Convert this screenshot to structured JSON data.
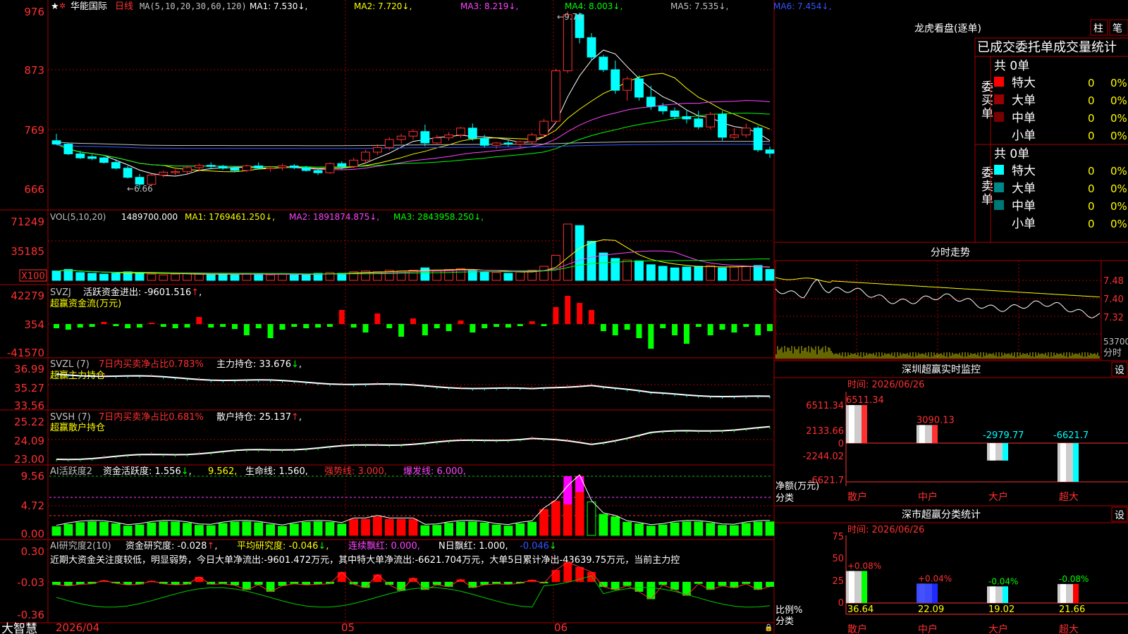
{
  "header": {
    "stock_name": "华能国际",
    "period": "日线",
    "ma_title": "MA(5,10,20,30,60,120)",
    "ma": [
      {
        "label": "MA1: 7.530",
        "arrow": "↓",
        "color": "#ffffff"
      },
      {
        "label": "MA2: 7.720",
        "arrow": "↓",
        "color": "#ffff00"
      },
      {
        "label": "MA3: 8.219",
        "arrow": "↓",
        "color": "#ff44ff"
      },
      {
        "label": "MA4: 8.003",
        "arrow": "↓",
        "color": "#00ff00"
      },
      {
        "label": "MA5: 7.535",
        "arrow": "↓",
        "color": "#c0c0c0"
      },
      {
        "label": "MA6: 7.454",
        "arrow": "↓",
        "color": "#3355ff"
      }
    ]
  },
  "price_axis": [
    "976",
    "873",
    "769",
    "666"
  ],
  "price_annotations": {
    "high": "9.76",
    "low": "6.66"
  },
  "vol_panel": {
    "title": "VOL(5,10,20)",
    "value": "1489700.000",
    "ma": [
      {
        "label": "MA1: 1769461.250",
        "arrow": "↓",
        "color": "#ffff00"
      },
      {
        "label": "MA2: 1891874.875",
        "arrow": "↓",
        "color": "#ff44ff"
      },
      {
        "label": "MA3: 2843958.250",
        "arrow": "↓",
        "color": "#00ff00"
      }
    ],
    "axis": [
      "71249",
      "35185"
    ],
    "unit": "X100"
  },
  "svzj_panel": {
    "name": "SVZJ",
    "line1": "活跃资金进出: -9601.516",
    "arrow": "↑",
    "line2": "超赢资金流(万元)",
    "axis": [
      "42279",
      "354",
      "-41570"
    ]
  },
  "svzl_panel": {
    "name": "SVZL (7)",
    "ratio": "7日内买卖净占比0.783%",
    "holding": "主力持仓: 33.676",
    "arrow": "↓",
    "line2": "超赢主力持仓",
    "axis": [
      "36.99",
      "35.27",
      "33.56"
    ]
  },
  "svsh_panel": {
    "name": "SVSH (7)",
    "ratio": "7日内买卖净占比0.681%",
    "holding": "散户持仓: 25.137",
    "arrow": "↑",
    "line2": "超赢散户持仓",
    "axis": [
      "25.22",
      "24.09",
      "23.00"
    ]
  },
  "ai_active_panel": {
    "name": "AI活跃度2",
    "activity": "资金活跃度: 1.556",
    "a1": "↓",
    "v2": "9.562",
    "life": "生命线: 1.560",
    "strong": "强势线: 3.000",
    "burst": "爆发线: 6.000",
    "axis": [
      "9.56",
      "4.72",
      "0.00"
    ]
  },
  "ai_research_panel": {
    "name": "AI研究度2(10)",
    "research": "资金研究度: -0.028",
    "avg": "平均研究度: -0.046",
    "lianxu": "连续飘红: 0.000",
    "nday": "N日飘红: 1.000",
    "last": "-0.046",
    "comment": "近期大资金关注度较低，明显弱势，今日大单净流出:-9601.472万元，其中特大单净流出:-6621.704万元，大单5日累计净出-43639.75万元，当前主力控",
    "axis": [
      "0.30",
      "-0.03",
      "-0.36"
    ]
  },
  "date_axis": {
    "brand": "大智慧",
    "labels": [
      "2026/04",
      "05",
      "06"
    ]
  },
  "dragon_tiger": {
    "title": "龙虎看盘(逐单)",
    "tabs": [
      "柱",
      "笔"
    ],
    "heading": "已成交委托单成交量统计",
    "buy_label": "委买单",
    "sell_label": "委卖单",
    "buy_total": "共 0单",
    "sell_total": "共 0单",
    "buy_rows": [
      {
        "label": "特大",
        "count": "0",
        "pct": "0%",
        "color": "#ff0000"
      },
      {
        "label": "大单",
        "count": "0",
        "pct": "0%",
        "color": "#990000"
      },
      {
        "label": "中单",
        "count": "0",
        "pct": "0%",
        "color": "#770000"
      },
      {
        "label": "小单",
        "count": "0",
        "pct": "0%",
        "color": ""
      }
    ],
    "sell_rows": [
      {
        "label": "特大",
        "count": "0",
        "pct": "0%",
        "color": "#00ffff"
      },
      {
        "label": "大单",
        "count": "0",
        "pct": "0%",
        "color": "#008888"
      },
      {
        "label": "中单",
        "count": "0",
        "pct": "0%",
        "color": "#007777"
      },
      {
        "label": "小单",
        "count": "0",
        "pct": "0%",
        "color": ""
      }
    ]
  },
  "intraday": {
    "title": "分时走势",
    "axis": [
      "7.48",
      "7.40",
      "7.32"
    ],
    "vol_axis": "53700",
    "vol_label": "分时"
  },
  "realtime_monitor": {
    "title": "深圳超赢实时监控",
    "setting": "设",
    "time": "时间: 2026/06/26",
    "axis": [
      "6511.34",
      "2133.66",
      "0",
      "-2244.02",
      "-6621.7"
    ],
    "bottom_label1": "净额(万元)",
    "bottom_label2": "分类",
    "categories": [
      "散户",
      "中户",
      "大户",
      "超大"
    ],
    "values": [
      6511.34,
      3090.13,
      -2979.77,
      -6621.7
    ],
    "value_labels": [
      "6511.34",
      "3090.13",
      "-2979.77",
      "-6621.7"
    ]
  },
  "category_stats": {
    "title": "深市超赢分类统计",
    "setting": "设",
    "time": "时间: 2026/06/26",
    "axis": [
      "75",
      "50",
      "25",
      "0"
    ],
    "bottom_label1": "比例%",
    "bottom_label2": "分类",
    "categories": [
      "散户",
      "中户",
      "大户",
      "超大"
    ],
    "values": [
      36.64,
      22.09,
      19.02,
      21.66
    ],
    "change_labels": [
      "+0.08%",
      "+0.04%",
      "-0.04%",
      "-0.08%"
    ],
    "change_colors": [
      "#ff3030",
      "#ff3030",
      "#00ff00",
      "#00ff00"
    ]
  },
  "chart_data": {
    "type": "candlestick",
    "title": "华能国际 日线",
    "x_labels": [
      "2026/04",
      "05",
      "06"
    ],
    "ylim": [
      6.66,
      9.76
    ],
    "ohlc": [
      [
        7.5,
        7.62,
        7.45,
        7.44
      ],
      [
        7.44,
        7.46,
        7.25,
        7.27
      ],
      [
        7.27,
        7.32,
        7.18,
        7.2
      ],
      [
        7.22,
        7.26,
        7.16,
        7.19
      ],
      [
        7.2,
        7.22,
        7.1,
        7.12
      ],
      [
        7.12,
        7.18,
        7.0,
        7.02
      ],
      [
        7.02,
        7.06,
        6.84,
        6.86
      ],
      [
        6.86,
        6.92,
        6.66,
        6.74
      ],
      [
        6.74,
        6.92,
        6.72,
        6.9
      ],
      [
        6.9,
        6.98,
        6.86,
        6.95
      ],
      [
        6.95,
        7.0,
        6.9,
        6.96
      ],
      [
        6.96,
        7.05,
        6.92,
        7.03
      ],
      [
        7.03,
        7.1,
        6.96,
        7.07
      ],
      [
        7.07,
        7.12,
        7.0,
        7.05
      ],
      [
        7.05,
        7.08,
        6.99,
        7.02
      ],
      [
        7.02,
        7.05,
        6.96,
        6.98
      ],
      [
        6.98,
        7.08,
        6.95,
        7.06
      ],
      [
        7.06,
        7.12,
        7.0,
        7.02
      ],
      [
        7.02,
        7.06,
        6.96,
        7.03
      ],
      [
        7.03,
        7.1,
        6.98,
        7.06
      ],
      [
        7.06,
        7.09,
        7.0,
        7.03
      ],
      [
        7.03,
        7.06,
        6.96,
        6.98
      ],
      [
        6.98,
        7.02,
        6.9,
        6.94
      ],
      [
        6.94,
        7.12,
        6.92,
        7.1
      ],
      [
        7.1,
        7.14,
        7.0,
        7.05
      ],
      [
        7.05,
        7.2,
        7.02,
        7.16
      ],
      [
        7.16,
        7.34,
        7.1,
        7.3
      ],
      [
        7.3,
        7.44,
        7.25,
        7.38
      ],
      [
        7.38,
        7.56,
        7.34,
        7.52
      ],
      [
        7.52,
        7.62,
        7.45,
        7.58
      ],
      [
        7.58,
        7.7,
        7.52,
        7.66
      ],
      [
        7.66,
        7.78,
        7.4,
        7.46
      ],
      [
        7.46,
        7.6,
        7.42,
        7.55
      ],
      [
        7.55,
        7.65,
        7.5,
        7.6
      ],
      [
        7.6,
        7.74,
        7.55,
        7.72
      ],
      [
        7.72,
        7.8,
        7.5,
        7.54
      ],
      [
        7.54,
        7.6,
        7.38,
        7.42
      ],
      [
        7.42,
        7.48,
        7.36,
        7.46
      ],
      [
        7.46,
        7.52,
        7.4,
        7.44
      ],
      [
        7.44,
        7.5,
        7.36,
        7.48
      ],
      [
        7.48,
        7.64,
        7.44,
        7.6
      ],
      [
        7.6,
        7.88,
        7.56,
        7.84
      ],
      [
        7.84,
        8.76,
        7.8,
        8.72
      ],
      [
        8.72,
        9.76,
        8.68,
        9.7
      ],
      [
        9.7,
        9.74,
        9.2,
        9.3
      ],
      [
        9.3,
        9.38,
        8.9,
        8.96
      ],
      [
        8.96,
        9.0,
        8.7,
        8.74
      ],
      [
        8.74,
        8.9,
        8.32,
        8.38
      ],
      [
        8.38,
        8.62,
        8.2,
        8.58
      ],
      [
        8.58,
        8.64,
        8.2,
        8.26
      ],
      [
        8.26,
        8.46,
        8.04,
        8.1
      ],
      [
        8.1,
        8.16,
        7.96,
        8.02
      ],
      [
        8.02,
        8.08,
        7.88,
        7.92
      ],
      [
        7.92,
        8.04,
        7.8,
        7.88
      ],
      [
        7.88,
        8.02,
        7.7,
        7.74
      ],
      [
        7.74,
        8.0,
        7.7,
        7.96
      ],
      [
        7.96,
        8.02,
        7.5,
        7.56
      ],
      [
        7.56,
        7.72,
        7.52,
        7.6
      ],
      [
        7.6,
        7.8,
        7.55,
        7.72
      ],
      [
        7.72,
        7.76,
        7.3,
        7.34
      ],
      [
        7.34,
        7.4,
        7.2,
        7.28
      ]
    ],
    "volume": [
      12,
      14,
      10,
      9,
      8,
      9,
      11,
      10,
      8,
      7,
      8,
      9,
      8,
      7,
      8,
      7,
      9,
      8,
      7,
      8,
      7,
      8,
      9,
      10,
      9,
      11,
      12,
      11,
      13,
      12,
      13,
      16,
      12,
      14,
      15,
      13,
      11,
      10,
      9,
      11,
      13,
      18,
      32,
      72,
      70,
      50,
      35,
      28,
      26,
      25,
      20,
      18,
      16,
      17,
      18,
      19,
      16,
      17,
      18,
      19,
      14
    ],
    "flow": [
      -6,
      -8,
      -5,
      -4,
      3,
      -3,
      -6,
      -5,
      2,
      -4,
      -6,
      -5,
      10,
      -5,
      -4,
      -7,
      -16,
      -6,
      -20,
      -8,
      -4,
      -6,
      -5,
      -4,
      20,
      -5,
      -12,
      15,
      -6,
      -18,
      8,
      -16,
      -6,
      -10,
      5,
      -12,
      -6,
      -4,
      -5,
      -3,
      4,
      -3,
      24,
      40,
      30,
      20,
      -10,
      -16,
      -8,
      -20,
      -35,
      -6,
      -16,
      -28,
      -4,
      -16,
      -8,
      -12,
      -4,
      -16,
      -10,
      -8
    ]
  }
}
